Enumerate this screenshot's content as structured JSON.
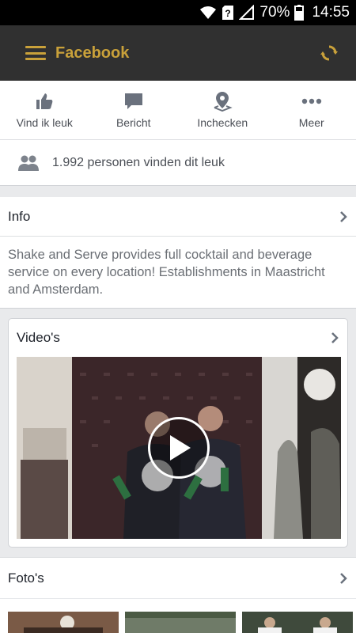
{
  "status_bar": {
    "battery": "70%",
    "time": "14:55"
  },
  "app_bar": {
    "title": "Facebook"
  },
  "actions": [
    {
      "label": "Vind ik leuk",
      "icon": "thumbs-up-icon"
    },
    {
      "label": "Bericht",
      "icon": "message-icon"
    },
    {
      "label": "Inchecken",
      "icon": "location-pin-icon"
    },
    {
      "label": "Meer",
      "icon": "more-dots-icon"
    }
  ],
  "likes": {
    "text": "1.992 personen vinden dit leuk",
    "icon": "people-icon"
  },
  "info": {
    "title": "Info",
    "text": "Shake and Serve provides full cocktail and beverage service on every location! Establishments in Maastricht and Amsterdam."
  },
  "videos": {
    "title": "Video's"
  },
  "photos": {
    "title": "Foto's"
  },
  "colors": {
    "accent": "#c9a13a",
    "toolbar": "#303030",
    "icon": "#6a717d"
  }
}
